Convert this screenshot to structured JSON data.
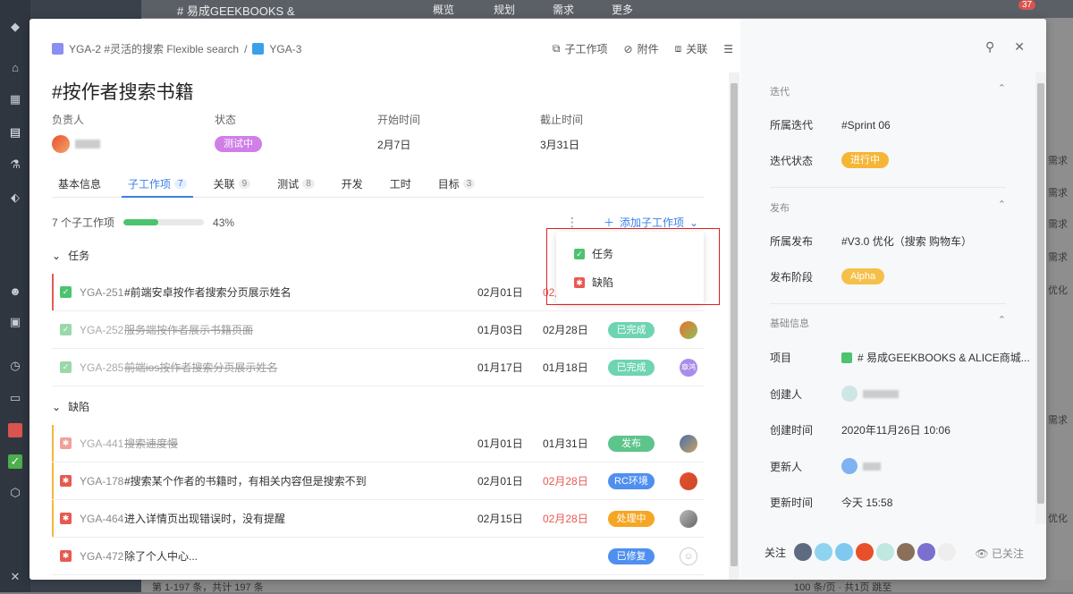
{
  "colors": {
    "accent": "#3a7fe6",
    "testing": "#d07fe8",
    "done": "#6fd4b1",
    "release": "#5dc48b",
    "rc": "#4f8ff0",
    "processing": "#f5a623",
    "fixed": "#4f8ff0",
    "iter": "#f5b638",
    "alpha": "#f5c04a",
    "late": "#e65a52"
  },
  "background": {
    "top_title": "# 易成GEEKBOOKS &",
    "top_tabs": [
      "概览",
      "规划",
      "需求",
      "更多"
    ],
    "notify_count": "37",
    "right_col_items": [
      "需求",
      "需求",
      "需求",
      "需求",
      "优化",
      "需求",
      "优化"
    ],
    "bottom_left": "第 1-197 条，共计 197 条",
    "bottom_right": "100 条/页 · 共1页 跳至"
  },
  "breadcrumb": {
    "parent": "YGA-2 #灵活的搜索 Flexible search",
    "sep": "/",
    "current": "YGA-3"
  },
  "top_actions": {
    "subitems": "子工作项",
    "attach": "附件",
    "link": "关联"
  },
  "title": "#按作者搜索书籍",
  "meta": {
    "assignee_label": "负责人",
    "status_label": "状态",
    "status": "测试中",
    "start_label": "开始时间",
    "start": "2月7日",
    "end_label": "截止时间",
    "end": "3月31日"
  },
  "tabs": [
    {
      "label": "基本信息",
      "count": ""
    },
    {
      "label": "子工作项",
      "count": "7"
    },
    {
      "label": "关联",
      "count": "9"
    },
    {
      "label": "测试",
      "count": "8"
    },
    {
      "label": "开发",
      "count": ""
    },
    {
      "label": "工时",
      "count": ""
    },
    {
      "label": "目标",
      "count": "3"
    }
  ],
  "progress": {
    "count_text": "7 个子工作项",
    "percent_text": "43%",
    "value": 0.43
  },
  "add_sub": "添加子工作项",
  "groups": {
    "task": "任务",
    "bug": "缺陷"
  },
  "dropdown": {
    "task": "任务",
    "bug": "缺陷"
  },
  "rows": [
    {
      "key": "YGA-251",
      "title": "#前端安卓按作者搜索分页展示姓名",
      "d1": "02月01日",
      "d2": "02月",
      "status": ""
    },
    {
      "key": "YGA-252",
      "title": "服务端按作者展示书籍页面",
      "d1": "01月03日",
      "d2": "02月28日",
      "status": "已完成"
    },
    {
      "key": "YGA-285",
      "title": "前端ios按作者搜索分页展示姓名",
      "d1": "01月17日",
      "d2": "01月18日",
      "status": "已完成",
      "avatar": "章鸿"
    },
    {
      "key": "YGA-441",
      "title": "搜索速度慢",
      "d1": "01月01日",
      "d2": "01月31日",
      "status": "发布"
    },
    {
      "key": "YGA-178",
      "title": "#搜索某个作者的书籍时，有相关内容但是搜索不到",
      "d1": "02月01日",
      "d2": "02月28日",
      "status": "RC环境"
    },
    {
      "key": "YGA-464",
      "title": "进入详情页出现错误时，没有提醒",
      "d1": "02月15日",
      "d2": "02月28日",
      "status": "处理中"
    },
    {
      "key": "YGA-472",
      "title": "除了个人中心...",
      "d1": "",
      "d2": "",
      "status": "已修复"
    }
  ],
  "right_panel": {
    "iteration_section": "迭代",
    "iter_label": "所属迭代",
    "iter_value": "#Sprint 06",
    "iter_status_label": "迭代状态",
    "iter_status": "进行中",
    "release_section": "发布",
    "release_label": "所属发布",
    "release_value": "#V3.0 优化（搜索 购物车）",
    "release_stage_label": "发布阶段",
    "release_stage": "Alpha",
    "basic_section": "基础信息",
    "project_label": "项目",
    "project_value": "# 易成GEEKBOOKS & ALICE商城...",
    "creator_label": "创建人",
    "created_label": "创建时间",
    "created_value": "2020年11月26日 10:06",
    "updater_label": "更新人",
    "updated_label": "更新时间",
    "updated_value": "今天 15:58",
    "follow_label": "关注",
    "followed": "已关注"
  }
}
